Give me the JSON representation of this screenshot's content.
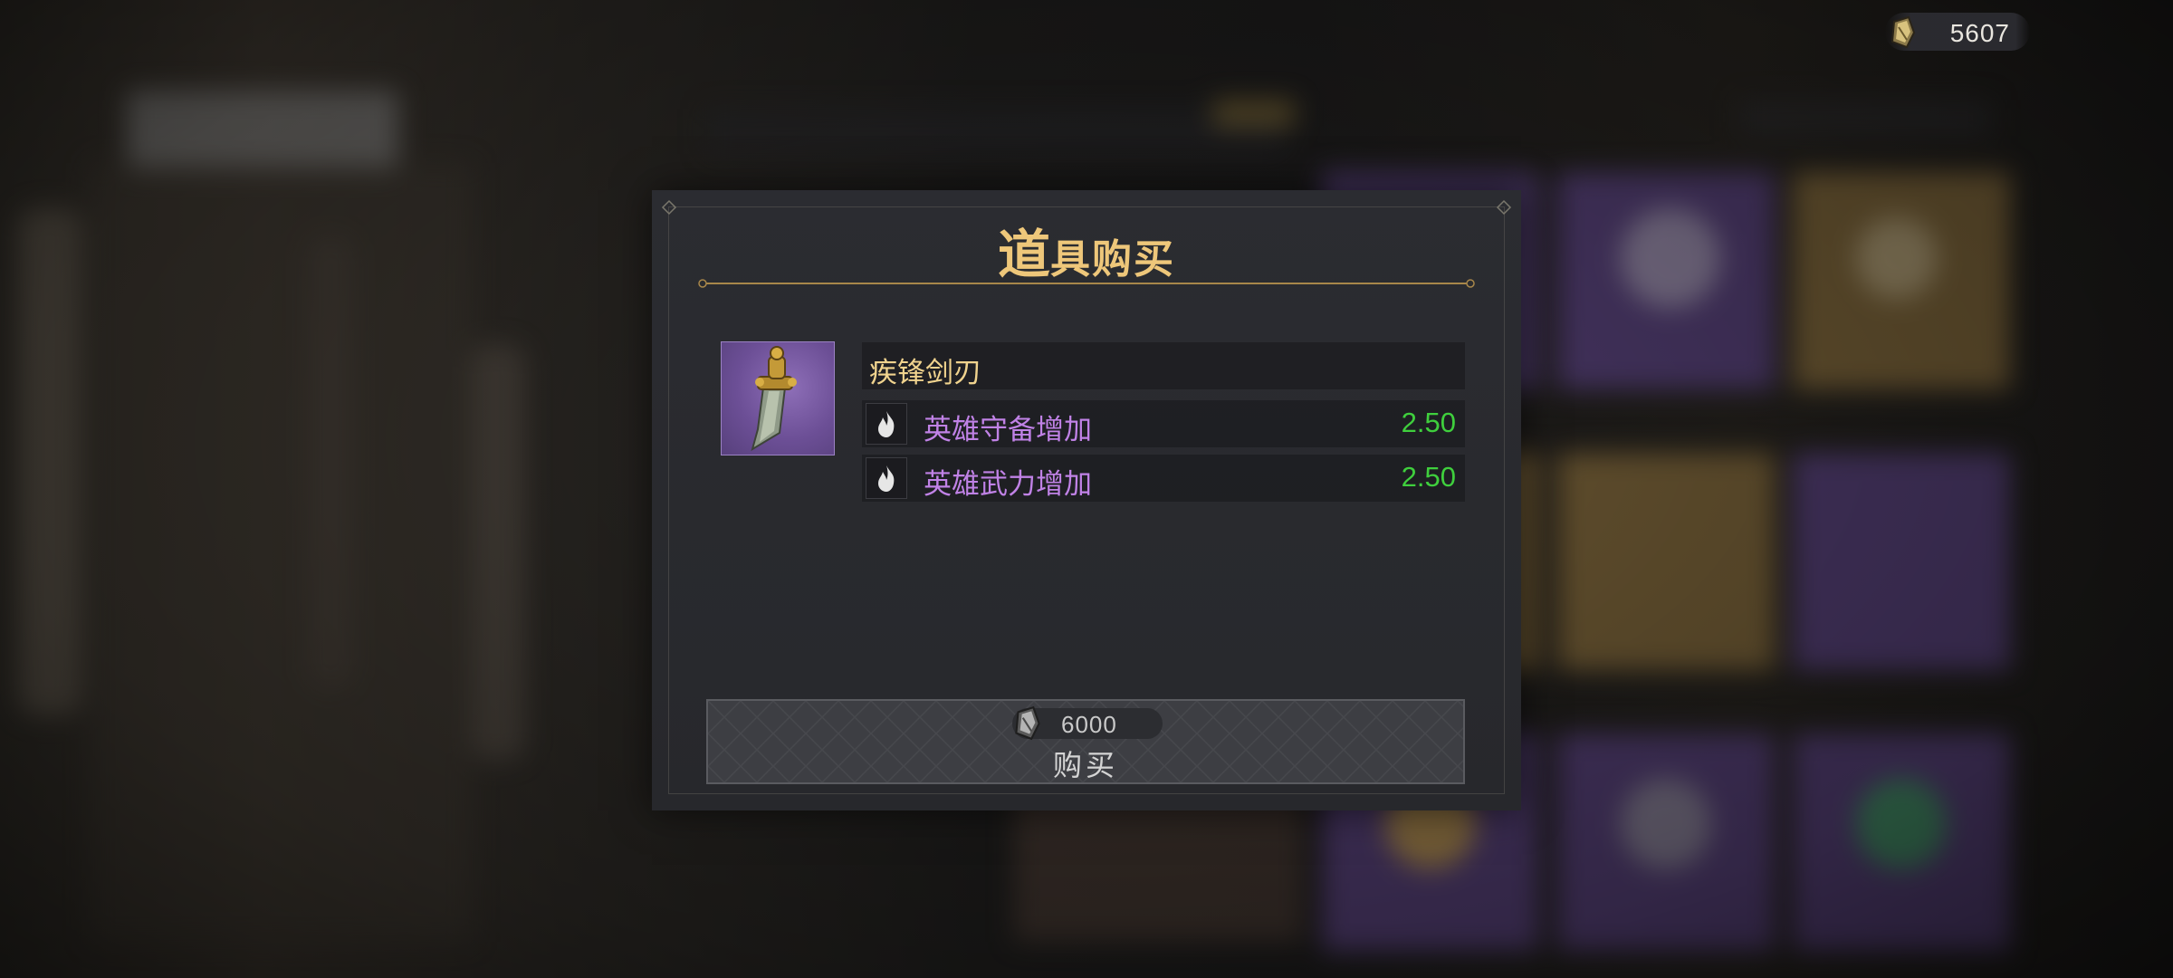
{
  "currency": {
    "icon": "gem-currency-icon",
    "amount": "5607"
  },
  "dialog": {
    "title_first": "道",
    "title_rest": "具购买",
    "item": {
      "name": "疾锋剑刃",
      "icon": "dagger-icon",
      "stats": [
        {
          "label": "英雄守备增加",
          "value": "2.50",
          "icon": "flame-icon"
        },
        {
          "label": "英雄武力增加",
          "value": "2.50",
          "icon": "flame-icon"
        }
      ]
    },
    "buy": {
      "price": "6000",
      "label": "购买",
      "icon": "gem-currency-icon"
    }
  },
  "colors": {
    "title": "#eec77a",
    "item_name": "#f0d38e",
    "stat_label": "#c082e6",
    "stat_value": "#3fcf3d",
    "rarity_purple": "#6c4f96"
  }
}
